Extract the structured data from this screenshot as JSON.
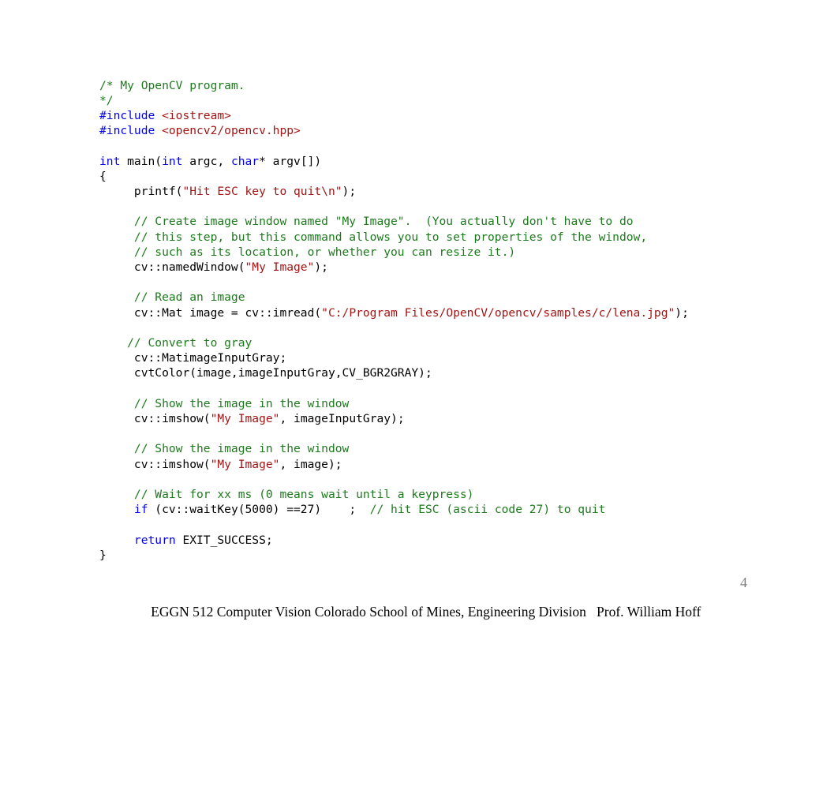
{
  "page": {
    "number": "4",
    "background": "#ffffff"
  },
  "colors": {
    "comment": "#1d7a1d",
    "string": "#a31515",
    "keyword": "#0000ee",
    "preprocessor": "#0000ee",
    "plain": "#000000",
    "page_number": "#808080",
    "footer": "#000000"
  },
  "code": {
    "language": "cpp",
    "lines": [
      {
        "id": 1,
        "tokens": [
          {
            "t": "cmt",
            "s": "/* My OpenCV program."
          }
        ]
      },
      {
        "id": 2,
        "tokens": [
          {
            "t": "cmt",
            "s": "*/"
          }
        ]
      },
      {
        "id": 3,
        "tokens": [
          {
            "t": "pp",
            "s": "#include"
          },
          {
            "t": "plain",
            "s": " "
          },
          {
            "t": "str",
            "s": "<iostream>"
          }
        ]
      },
      {
        "id": 4,
        "tokens": [
          {
            "t": "pp",
            "s": "#include"
          },
          {
            "t": "plain",
            "s": " "
          },
          {
            "t": "str",
            "s": "<opencv2/opencv.hpp>"
          }
        ]
      },
      {
        "id": 5,
        "tokens": []
      },
      {
        "id": 6,
        "tokens": [
          {
            "t": "kw",
            "s": "int"
          },
          {
            "t": "plain",
            "s": " main("
          },
          {
            "t": "kw",
            "s": "int"
          },
          {
            "t": "plain",
            "s": " argc, "
          },
          {
            "t": "kw",
            "s": "char"
          },
          {
            "t": "plain",
            "s": "* argv[])"
          }
        ]
      },
      {
        "id": 7,
        "tokens": [
          {
            "t": "plain",
            "s": "{"
          }
        ]
      },
      {
        "id": 8,
        "tokens": [
          {
            "t": "plain",
            "s": "     printf("
          },
          {
            "t": "str",
            "s": "\"Hit ESC key to quit\\n\""
          },
          {
            "t": "plain",
            "s": ");"
          }
        ]
      },
      {
        "id": 9,
        "tokens": []
      },
      {
        "id": 10,
        "tokens": [
          {
            "t": "cmt",
            "s": "     // Create image window named \"My Image\".  (You actually don't have to do"
          }
        ]
      },
      {
        "id": 11,
        "tokens": [
          {
            "t": "cmt",
            "s": "     // this step, but this command allows you to set properties of the window,"
          }
        ]
      },
      {
        "id": 12,
        "tokens": [
          {
            "t": "cmt",
            "s": "     // such as its location, or whether you can resize it.)"
          }
        ]
      },
      {
        "id": 13,
        "tokens": [
          {
            "t": "plain",
            "s": "     cv::namedWindow("
          },
          {
            "t": "str",
            "s": "\"My Image\""
          },
          {
            "t": "plain",
            "s": ");"
          }
        ]
      },
      {
        "id": 14,
        "tokens": []
      },
      {
        "id": 15,
        "tokens": [
          {
            "t": "cmt",
            "s": "     // Read an image"
          }
        ]
      },
      {
        "id": 16,
        "tokens": [
          {
            "t": "plain",
            "s": "     cv::Mat image = cv::imread("
          },
          {
            "t": "str",
            "s": "\"C:/Program Files/OpenCV/opencv/samples/c/lena.jpg\""
          },
          {
            "t": "plain",
            "s": ");"
          }
        ]
      },
      {
        "id": 17,
        "tokens": []
      },
      {
        "id": 18,
        "tokens": [
          {
            "t": "cmt",
            "s": "    // Convert to gray"
          }
        ]
      },
      {
        "id": 19,
        "tokens": [
          {
            "t": "plain",
            "s": "     cv::MatimageInputGray;"
          }
        ]
      },
      {
        "id": 20,
        "tokens": [
          {
            "t": "plain",
            "s": "     cvtColor(image,imageInputGray,CV_BGR2GRAY);"
          }
        ]
      },
      {
        "id": 21,
        "tokens": []
      },
      {
        "id": 22,
        "tokens": [
          {
            "t": "cmt",
            "s": "     // Show the image in the window"
          }
        ]
      },
      {
        "id": 23,
        "tokens": [
          {
            "t": "plain",
            "s": "     cv::imshow("
          },
          {
            "t": "str",
            "s": "\"My Image\""
          },
          {
            "t": "plain",
            "s": ", imageInputGray);"
          }
        ]
      },
      {
        "id": 24,
        "tokens": []
      },
      {
        "id": 25,
        "tokens": [
          {
            "t": "cmt",
            "s": "     // Show the image in the window"
          }
        ]
      },
      {
        "id": 26,
        "tokens": [
          {
            "t": "plain",
            "s": "     cv::imshow("
          },
          {
            "t": "str",
            "s": "\"My Image\""
          },
          {
            "t": "plain",
            "s": ", image);"
          }
        ]
      },
      {
        "id": 27,
        "tokens": []
      },
      {
        "id": 28,
        "tokens": [
          {
            "t": "cmt",
            "s": "     // Wait for xx ms (0 means wait until a keypress)"
          }
        ]
      },
      {
        "id": 29,
        "tokens": [
          {
            "t": "plain",
            "s": "     "
          },
          {
            "t": "kw",
            "s": "if"
          },
          {
            "t": "plain",
            "s": " (cv::waitKey(5000) ==27)    ;  "
          },
          {
            "t": "cmt",
            "s": "// hit ESC (ascii code 27) to quit"
          }
        ]
      },
      {
        "id": 30,
        "tokens": []
      },
      {
        "id": 31,
        "tokens": [
          {
            "t": "plain",
            "s": "     "
          },
          {
            "t": "kw",
            "s": "return"
          },
          {
            "t": "plain",
            "s": " EXIT_SUCCESS;"
          }
        ]
      },
      {
        "id": 32,
        "tokens": [
          {
            "t": "plain",
            "s": "}"
          }
        ]
      }
    ]
  },
  "footer": {
    "course": "EGGN 512 Computer Vision",
    "institution": "Colorado School of Mines, Engineering Division",
    "instructor": "Prof. William Hoff",
    "separator_1": " ",
    "separator_2": "   "
  }
}
